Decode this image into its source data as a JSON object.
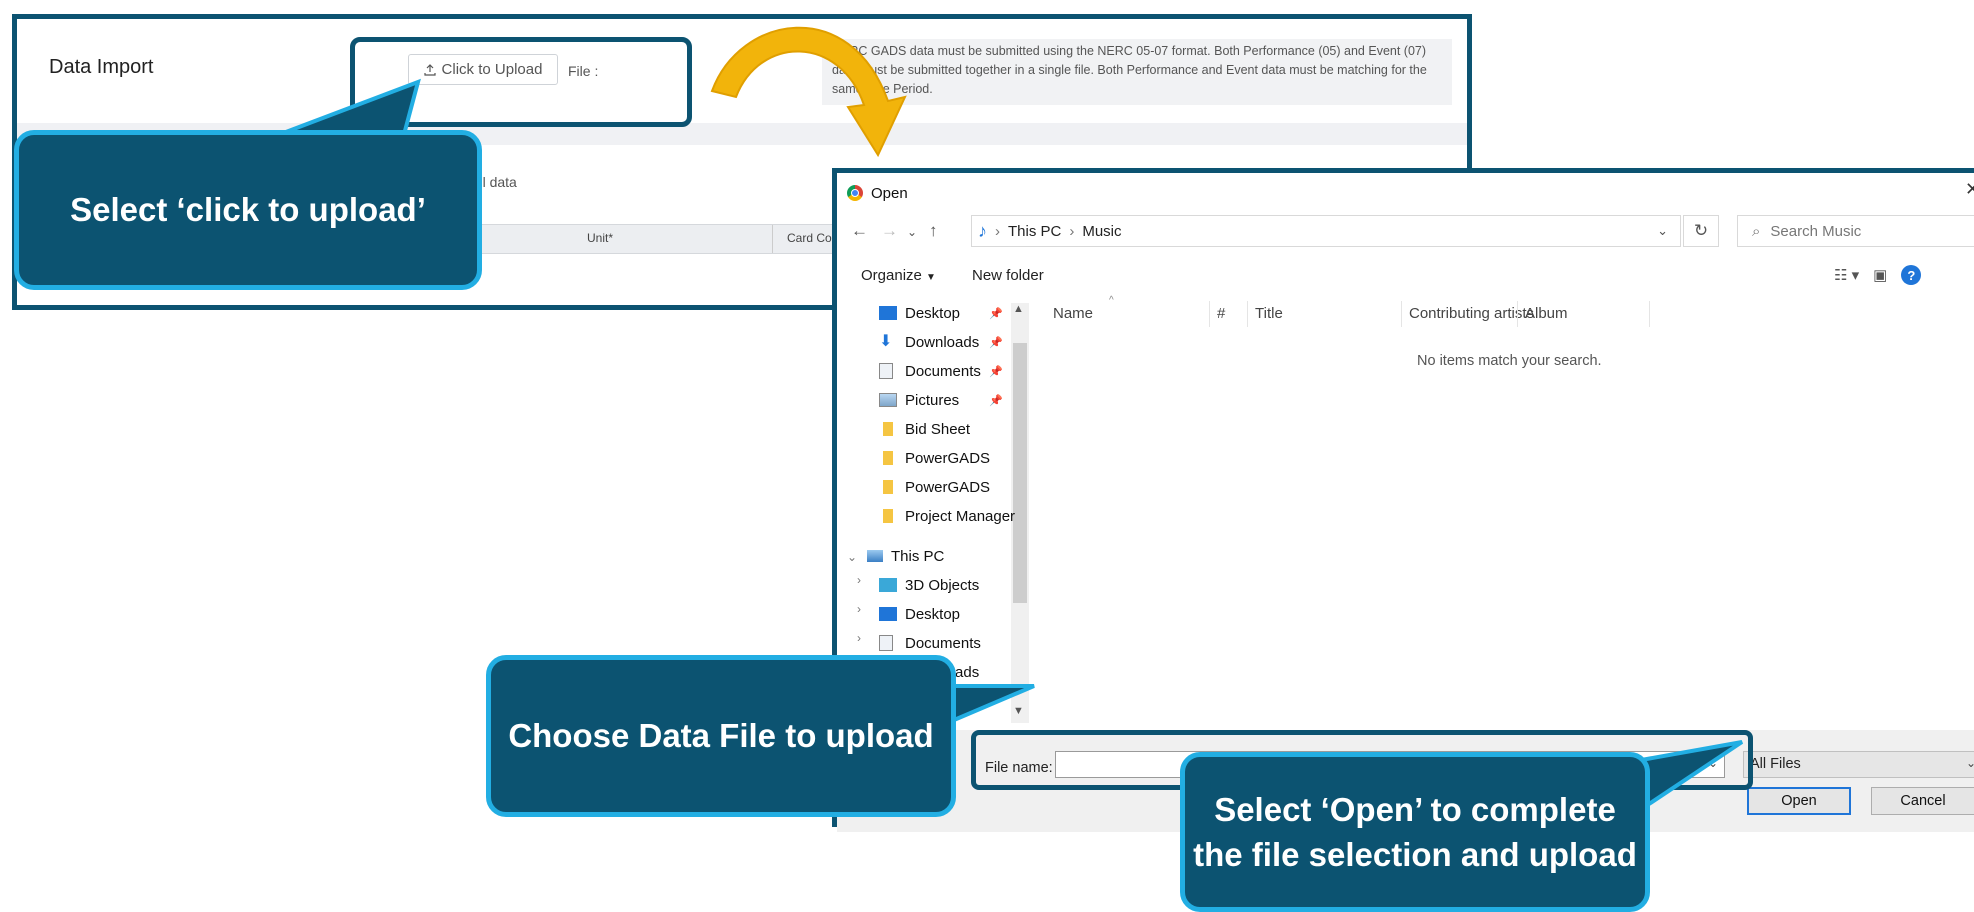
{
  "app": {
    "title": "Data Import",
    "upload_button": "Click to Upload",
    "file_label": "File :",
    "notice": "NERC GADS data must be submitted using the NERC 05-07 format. Both Performance (05) and Event (07) data must be submitted together in a single file. Both Performance and Event data must be matching for the same time Period.",
    "tab_text": "uel data",
    "grid": {
      "col_unit": "Unit*",
      "col_card": "Card Cod"
    }
  },
  "callouts": {
    "select_upload": "Select ‘click to upload’",
    "choose_file": "Choose Data File to upload",
    "select_open_line1": "Select ‘Open’ to complete",
    "select_open_line2": "the file selection and upload"
  },
  "dialog": {
    "title": "Open",
    "breadcrumb": [
      "This PC",
      "Music"
    ],
    "search_placeholder": "Search Music",
    "organize": "Organize",
    "new_folder": "New folder",
    "quick_access": [
      {
        "label": "Desktop",
        "pinned": true
      },
      {
        "label": "Downloads",
        "pinned": true
      },
      {
        "label": "Documents",
        "pinned": true
      },
      {
        "label": "Pictures",
        "pinned": true
      },
      {
        "label": "Bid Sheet",
        "pinned": false
      },
      {
        "label": "PowerGADS",
        "pinned": false
      },
      {
        "label": "PowerGADS",
        "pinned": false
      },
      {
        "label": "Project Manager",
        "pinned": false
      }
    ],
    "this_pc": "This PC",
    "this_pc_items": [
      "3D Objects",
      "Desktop",
      "Documents",
      "Downloads"
    ],
    "columns": [
      "Name",
      "#",
      "Title",
      "Contributing artists",
      "Album"
    ],
    "empty_message": "No items match your search.",
    "file_name_label": "File name:",
    "file_name_value": "",
    "file_type": "All Files",
    "open_button": "Open",
    "cancel_button": "Cancel"
  },
  "colors": {
    "callout_fill": "#0c5371",
    "callout_border": "#22aee3",
    "arrow": "#f2b40b",
    "highlight_frame": "#0c5371"
  }
}
